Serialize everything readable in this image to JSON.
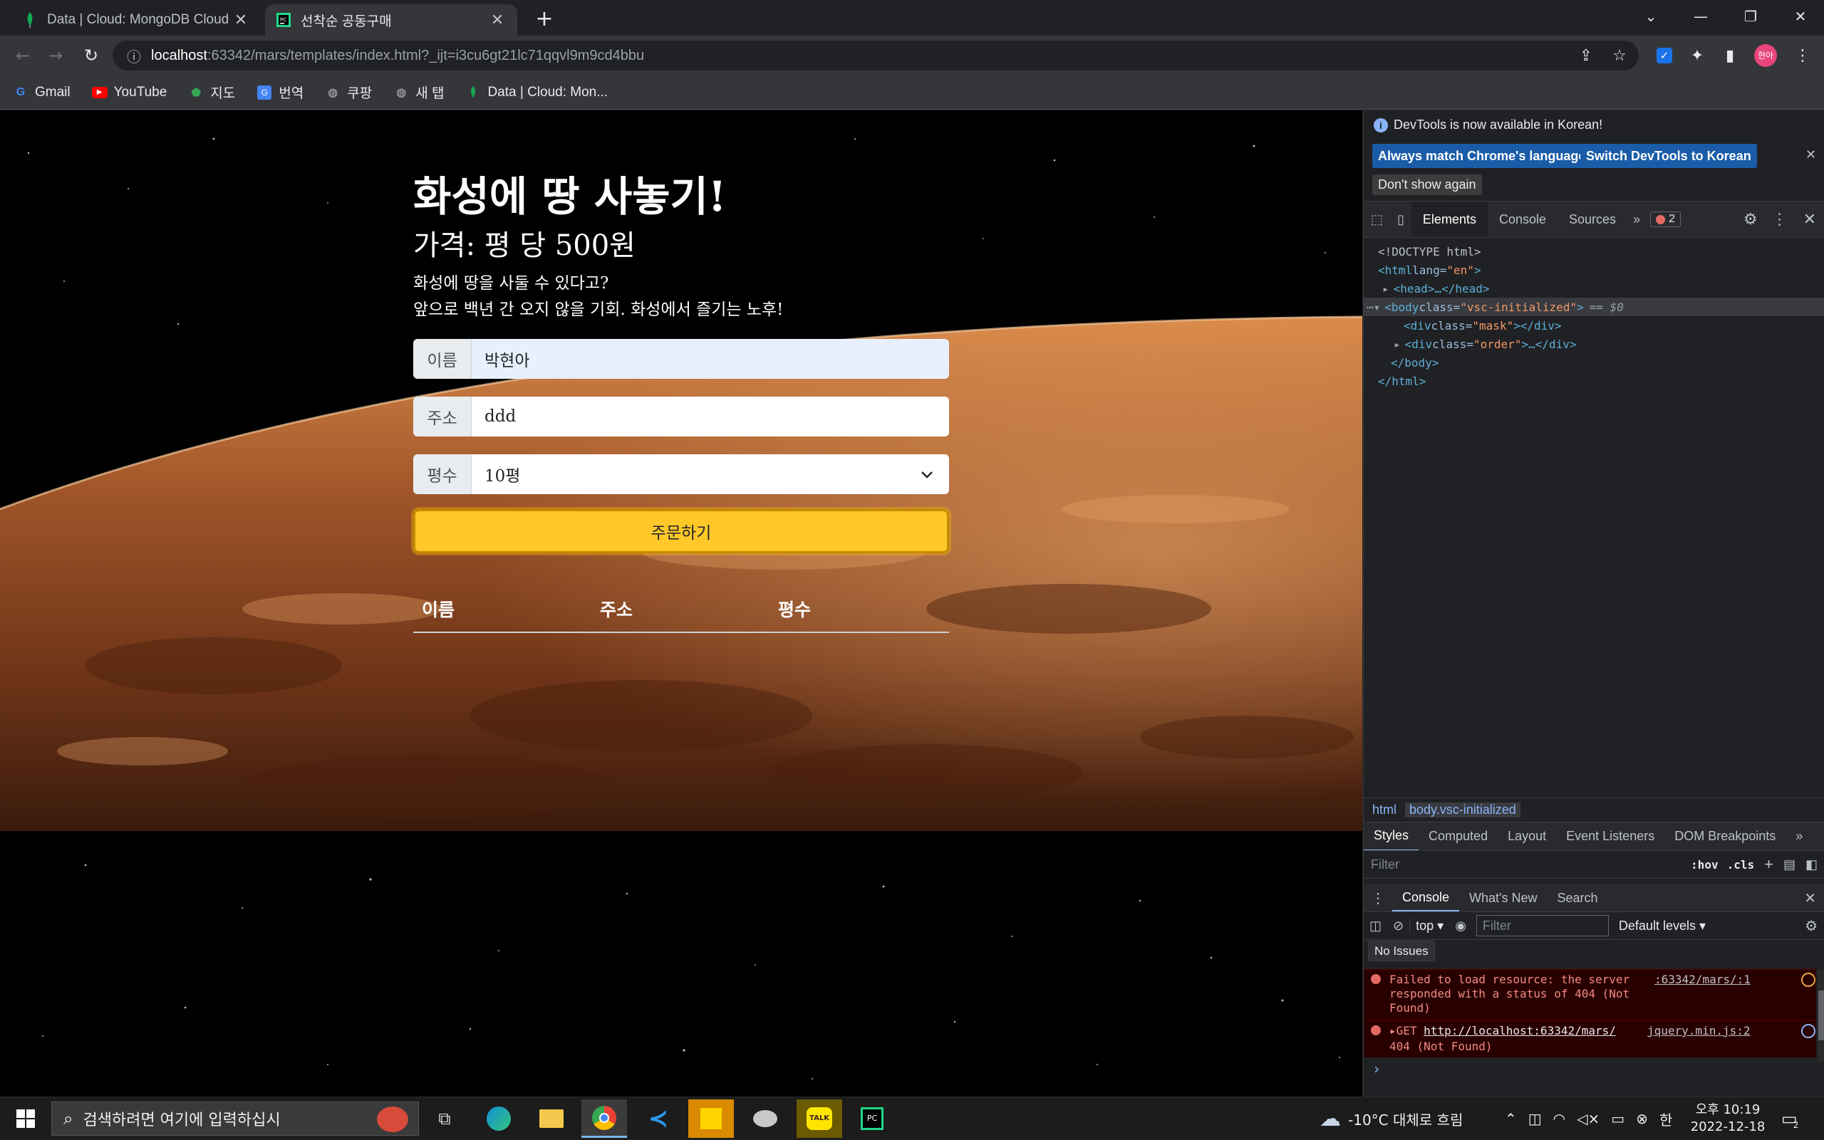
{
  "browser": {
    "tabs": [
      {
        "title": "Data | Cloud: MongoDB Cloud",
        "close": "✕"
      },
      {
        "title": "선착순 공동구매",
        "close": "✕"
      }
    ],
    "new_tab": "+",
    "address": {
      "host": "localhost",
      "rest": ":63342/mars/templates/index.html?_ijt=i3cu6gt21lc71qqvl9m9cd4bbu"
    },
    "profile_initials": "현아",
    "bookmarks": [
      "Gmail",
      "YouTube",
      "지도",
      "번역",
      "쿠팡",
      "새 탭",
      "Data | Cloud: Mon..."
    ]
  },
  "page": {
    "title": "화성에 땅 사놓기!",
    "price": "가격: 평 당 500원",
    "desc_line1": "화성에 땅을 사둘 수 있다고?",
    "desc_line2": "앞으로 백년 간 오지 않을 기회. 화성에서 즐기는 노후!",
    "form": {
      "name_label": "이름",
      "name_value": "박현아",
      "address_label": "주소",
      "address_value": "ddd",
      "size_label": "평수",
      "size_value": "10평"
    },
    "order_button": "주문하기",
    "table_headers": [
      "이름",
      "주소",
      "평수"
    ]
  },
  "devtools": {
    "banner": "DevTools is now available in Korean!",
    "btn_match": "Always match Chrome's language",
    "btn_switch": "Switch DevTools to Korean",
    "btn_dont_show": "Don't show again",
    "tabs": [
      "Elements",
      "Console",
      "Sources"
    ],
    "error_count": "2",
    "dom": {
      "doctype": "<!DOCTYPE html>",
      "html_open_tag": "<html ",
      "html_attr": "lang=",
      "html_val": "\"en\"",
      "head": "<head>…</head>",
      "body_tag": "<body ",
      "body_attr": "class=",
      "body_val": "\"vsc-initialized\"",
      "body_sel": "== $0",
      "div_mask_tag": "<div ",
      "div_mask_attr": "class=",
      "div_mask_val": "\"mask\"",
      "div_mask_close": "></div>",
      "div_order_tag": "<div ",
      "div_order_attr": "class=",
      "div_order_val": "\"order\"",
      "div_order_close": ">…</div>",
      "body_close": "</body>",
      "html_close": "</html>"
    },
    "breadcrumbs": [
      "html",
      "body.vsc-initialized"
    ],
    "style_tabs": [
      "Styles",
      "Computed",
      "Layout",
      "Event Listeners",
      "DOM Breakpoints"
    ],
    "filter_placeholder": "Filter",
    "hov": ":hov",
    "cls": ".cls",
    "drawer_tabs": [
      "Console",
      "What's New",
      "Search"
    ],
    "context": "top",
    "levels": "Default levels",
    "no_issues": "No Issues",
    "errors": [
      {
        "text": "Failed to load resource: the server responded with a status of 404 (Not Found)",
        "source": ":63342/mars/:1"
      },
      {
        "prefix": "GET ",
        "url": "http://localhost:63342/mars/",
        "rest": "404 (Not Found)",
        "source": "jquery.min.js:2"
      }
    ],
    "prompt": "›"
  },
  "taskbar": {
    "search_placeholder": "검색하려면 여기에 입력하십시",
    "weather": "-10°C 대체로 흐림",
    "ime": "한",
    "time": "오후 10:19",
    "date": "2022-12-18",
    "notif_count": "2"
  },
  "colors": {
    "accent_button": "#ffc828",
    "devtools_link": "#1a5ca8",
    "error_bg": "#290000"
  }
}
